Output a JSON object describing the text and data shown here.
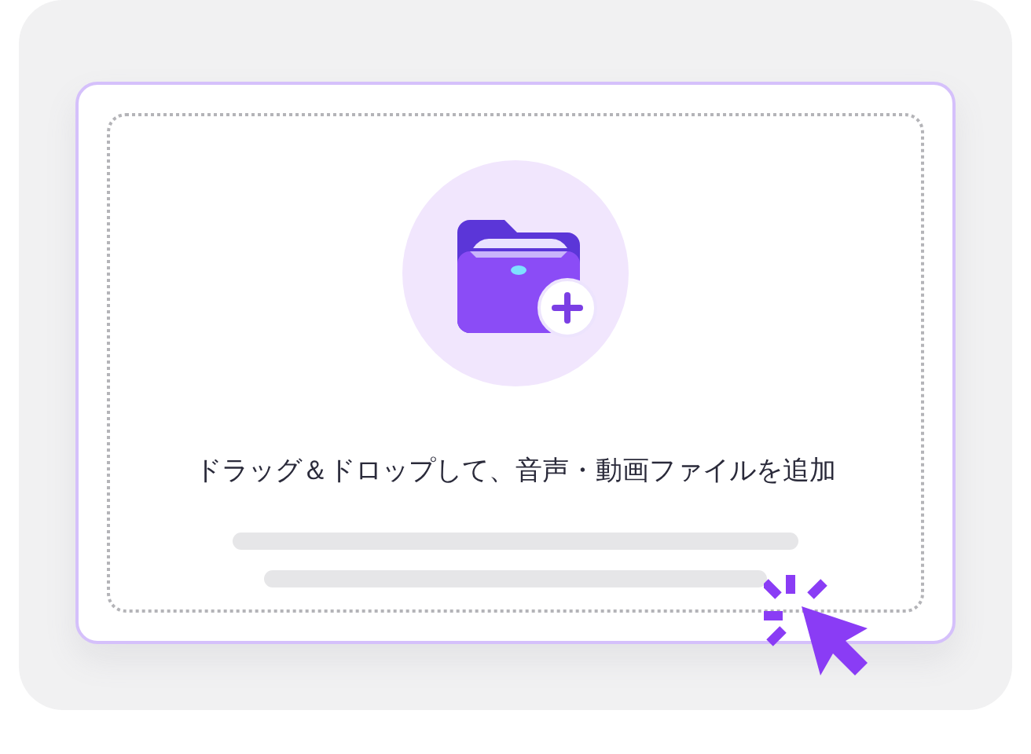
{
  "upload": {
    "instruction": "ドラッグ＆ドロップして、音声・動画ファイルを追加"
  }
}
